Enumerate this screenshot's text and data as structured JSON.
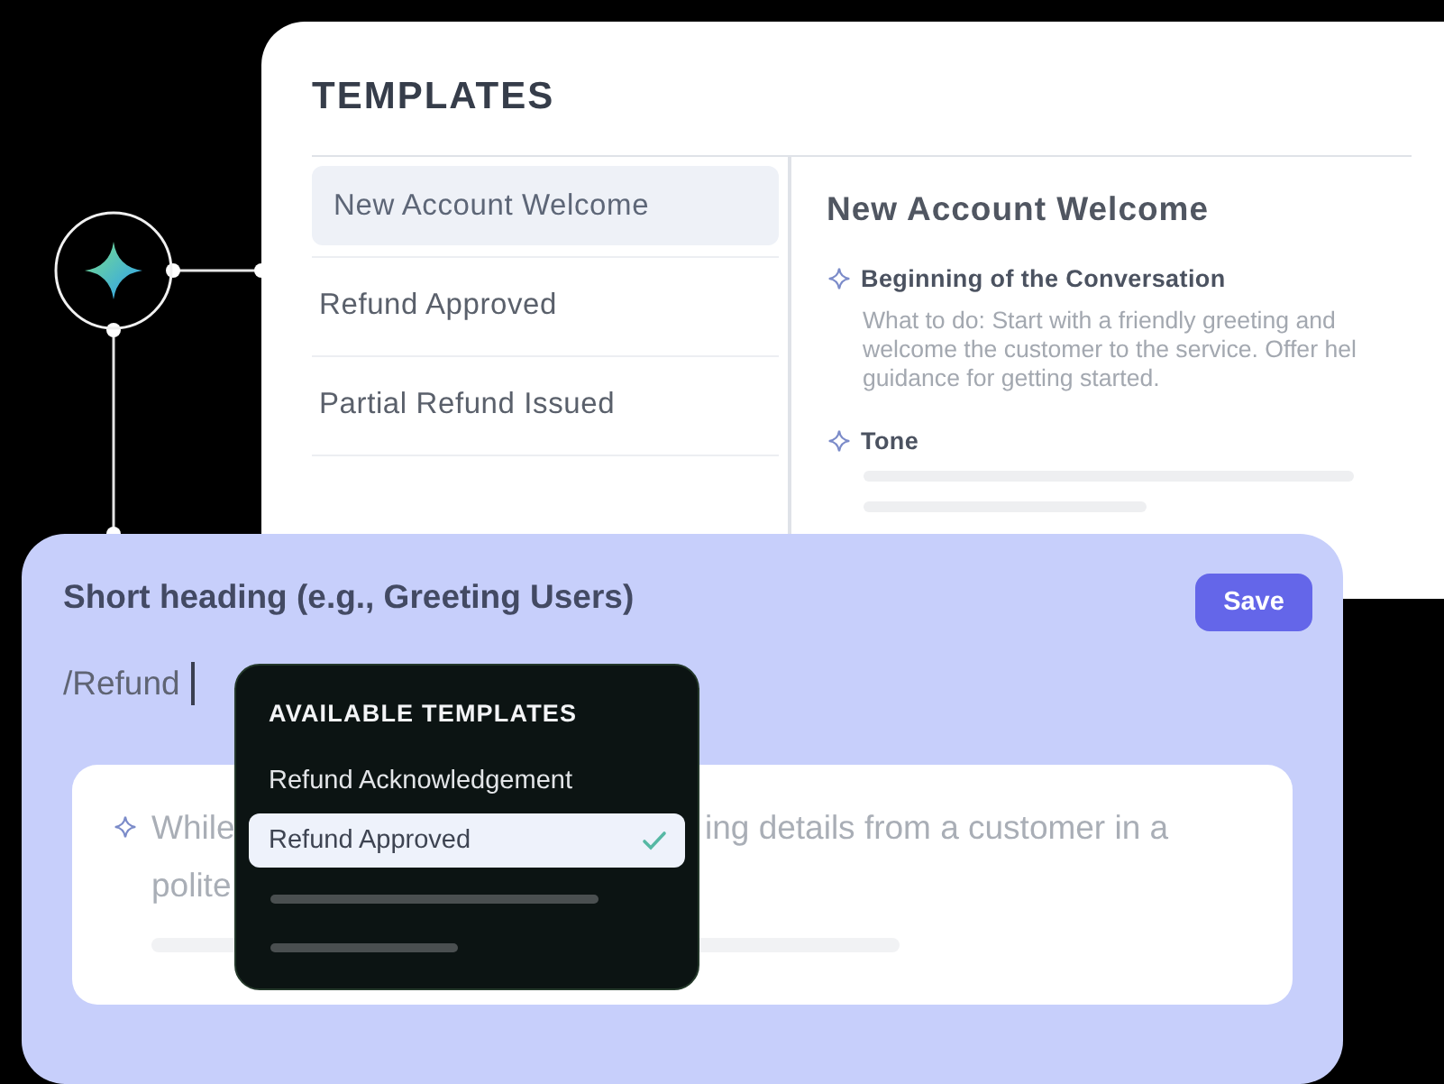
{
  "templates_panel": {
    "title": "TEMPLATES",
    "items": [
      {
        "label": "New Account Welcome",
        "selected": true
      },
      {
        "label": "Refund Approved",
        "selected": false
      },
      {
        "label": "Partial Refund Issued",
        "selected": false
      }
    ],
    "detail": {
      "heading": "New Account Welcome",
      "sections": [
        {
          "title": "Beginning of the Conversation",
          "lines": [
            "What to do: Start with a friendly greeting and",
            "welcome the customer to the service. Offer hel",
            "guidance for getting started."
          ]
        },
        {
          "title": "Tone"
        }
      ]
    }
  },
  "editor": {
    "heading": "Short heading (e.g., Greeting Users)",
    "save_button": "Save",
    "command_value": "/Refund",
    "body_lines": [
      {
        "parts": [
          "While",
          "ing details from a customer in a"
        ]
      },
      {
        "parts": [
          "polite"
        ]
      }
    ]
  },
  "dropdown": {
    "title": "AVAILABLE TEMPLATES",
    "items": [
      {
        "label": "Refund Acknowledgement",
        "selected": false
      },
      {
        "label": "Refund Approved",
        "selected": true
      }
    ]
  }
}
